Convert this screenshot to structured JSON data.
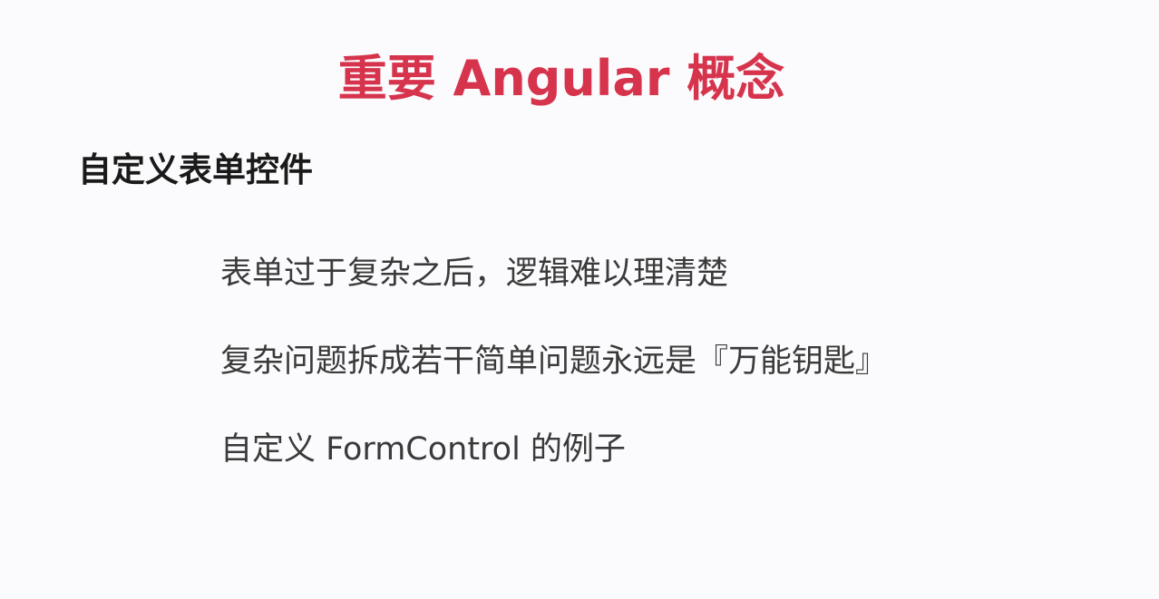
{
  "slide": {
    "title": "重要 Angular 概念",
    "subtitle": "自定义表单控件",
    "bullets": [
      "表单过于复杂之后，逻辑难以理清楚",
      "复杂问题拆成若干简单问题永远是『万能钥匙』",
      "自定义 FormControl 的例子"
    ]
  },
  "colors": {
    "title": "#d6334c",
    "subtitle": "#1a1a1a",
    "body_text": "#3a3a3a",
    "background": "#fbfafc"
  }
}
